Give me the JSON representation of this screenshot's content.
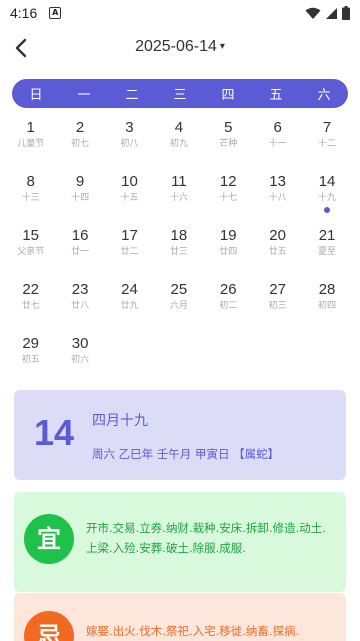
{
  "status": {
    "time": "4:16",
    "notification_icon": "A"
  },
  "header": {
    "date": "2025-06-14",
    "caret": "▾"
  },
  "weekdays": [
    "日",
    "一",
    "二",
    "三",
    "四",
    "五",
    "六"
  ],
  "days": [
    {
      "n": "1",
      "l": "儿童节"
    },
    {
      "n": "2",
      "l": "初七"
    },
    {
      "n": "3",
      "l": "初八"
    },
    {
      "n": "4",
      "l": "初九"
    },
    {
      "n": "5",
      "l": "芒种"
    },
    {
      "n": "6",
      "l": "十一"
    },
    {
      "n": "7",
      "l": "十二"
    },
    {
      "n": "8",
      "l": "十三"
    },
    {
      "n": "9",
      "l": "十四"
    },
    {
      "n": "10",
      "l": "十五"
    },
    {
      "n": "11",
      "l": "十六"
    },
    {
      "n": "12",
      "l": "十七"
    },
    {
      "n": "13",
      "l": "十八"
    },
    {
      "n": "14",
      "l": "十九"
    },
    {
      "n": "15",
      "l": "父亲节"
    },
    {
      "n": "16",
      "l": "廿一"
    },
    {
      "n": "17",
      "l": "廿二"
    },
    {
      "n": "18",
      "l": "廿三"
    },
    {
      "n": "19",
      "l": "廿四"
    },
    {
      "n": "20",
      "l": "廿五"
    },
    {
      "n": "21",
      "l": "夏至"
    },
    {
      "n": "22",
      "l": "廿七"
    },
    {
      "n": "23",
      "l": "廿八"
    },
    {
      "n": "24",
      "l": "廿九"
    },
    {
      "n": "25",
      "l": "六月"
    },
    {
      "n": "26",
      "l": "初二"
    },
    {
      "n": "27",
      "l": "初三"
    },
    {
      "n": "28",
      "l": "初四"
    },
    {
      "n": "29",
      "l": "初五"
    },
    {
      "n": "30",
      "l": "初六"
    }
  ],
  "selected_day": "14",
  "detail": {
    "day": "14",
    "lunar_date": "四月十九",
    "ganzhi": "周六 乙巳年 壬午月 甲寅日 【属蛇】"
  },
  "yi": {
    "label": "宜",
    "text": "开市.交易.立券.纳财.栽种.安床.拆卸.修造.动土.上梁.入殓.安葬.破土.除服.成服."
  },
  "ji": {
    "label": "忌",
    "text": "嫁娶.出火.伐木.祭祀.入宅.移徙.纳畜.探病."
  },
  "colors": {
    "accent": "#5b5bd6",
    "yi": "#1fc14a",
    "ji": "#f26a21"
  }
}
